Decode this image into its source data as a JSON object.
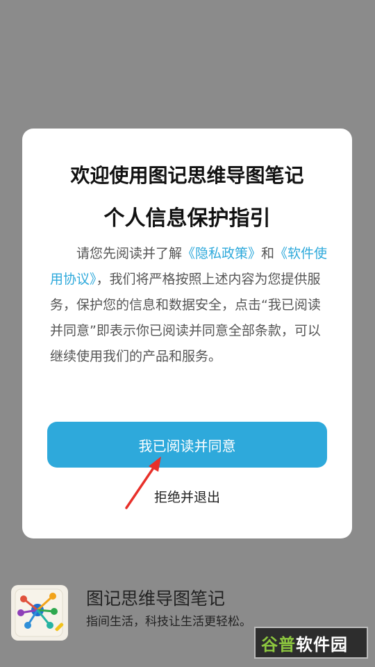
{
  "dialog": {
    "title_line1": "欢迎使用图记思维导图笔记",
    "title_line2": "个人信息保护指引",
    "body": {
      "part1": "请您先阅读并了解",
      "privacy_link": "《隐私政策》",
      "part2": "和",
      "terms_link": "《软件使用协议》",
      "part3": "，我们将严格按照上述内容为您提供服务，保护您的信息和数据安全，点击“我已阅读并同意”即表示你已阅读并同意全部条款，可以继续使用我们的产品和服务。"
    },
    "agree_label": "我已阅读并同意",
    "reject_label": "拒绝并退出"
  },
  "app": {
    "name": "图记思维导图笔记",
    "slogan": "指间生活，科技让生活更轻松。"
  },
  "watermark": {
    "part1": "谷普",
    "part2": "软件园"
  },
  "colors": {
    "accent": "#2ea9db",
    "overlay": "#8b8b8b",
    "arrow": "#e8302a"
  }
}
